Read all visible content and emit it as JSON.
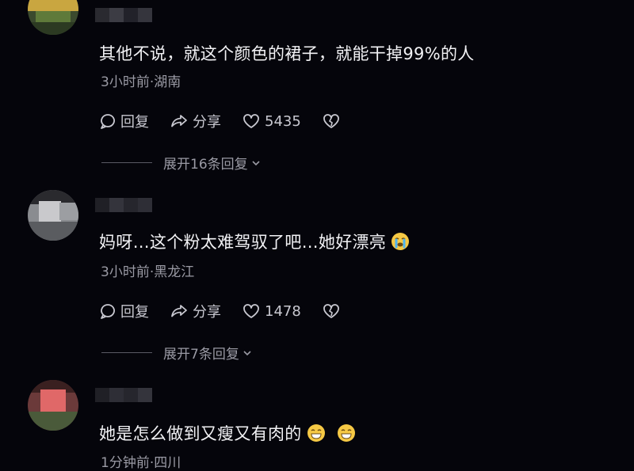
{
  "comments": [
    {
      "text": "其他不说，就这个颜色的裙子，就能干掉99%的人",
      "meta": "3小时前·湖南",
      "reply_label": "回复",
      "share_label": "分享",
      "like_count": "5435",
      "expand_label": "展开16条回复"
    },
    {
      "text": "妈呀…这个粉太难驾驭了吧…她好漂亮",
      "meta": "3小时前·黑龙江",
      "reply_label": "回复",
      "share_label": "分享",
      "like_count": "1478",
      "expand_label": "展开7条回复"
    },
    {
      "text": "她是怎么做到又瘦又有肉的",
      "meta": "1分钟前·四川"
    }
  ],
  "icons": [
    "comment-bubble-icon",
    "share-arrow-icon",
    "heart-icon",
    "broken-heart-icon",
    "chevron-down-icon",
    "crying-face-emoji",
    "grinning-face-emoji"
  ],
  "colors": {
    "background": "#05050b",
    "text": "#f2f2f5",
    "meta": "#9a9aa4"
  }
}
